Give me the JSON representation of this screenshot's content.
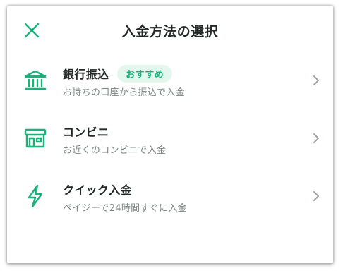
{
  "header": {
    "title": "入金方法の選択",
    "close_icon": "close-icon"
  },
  "colors": {
    "accent": "#17b37b",
    "badge_bg": "#e4f7ef",
    "title_text": "#222826",
    "desc_text": "#7c8583",
    "chevron": "#9aa3a1"
  },
  "methods": [
    {
      "label": "銀行振込",
      "badge": "おすすめ",
      "description": "お持ちの口座から振込で入金",
      "icon": "bank-icon"
    },
    {
      "label": "コンビニ",
      "description": "お近くのコンビニで入金",
      "icon": "store-icon"
    },
    {
      "label": "クイック入金",
      "description": "ペイジーで24時間すぐに入金",
      "icon": "lightning-icon"
    }
  ]
}
